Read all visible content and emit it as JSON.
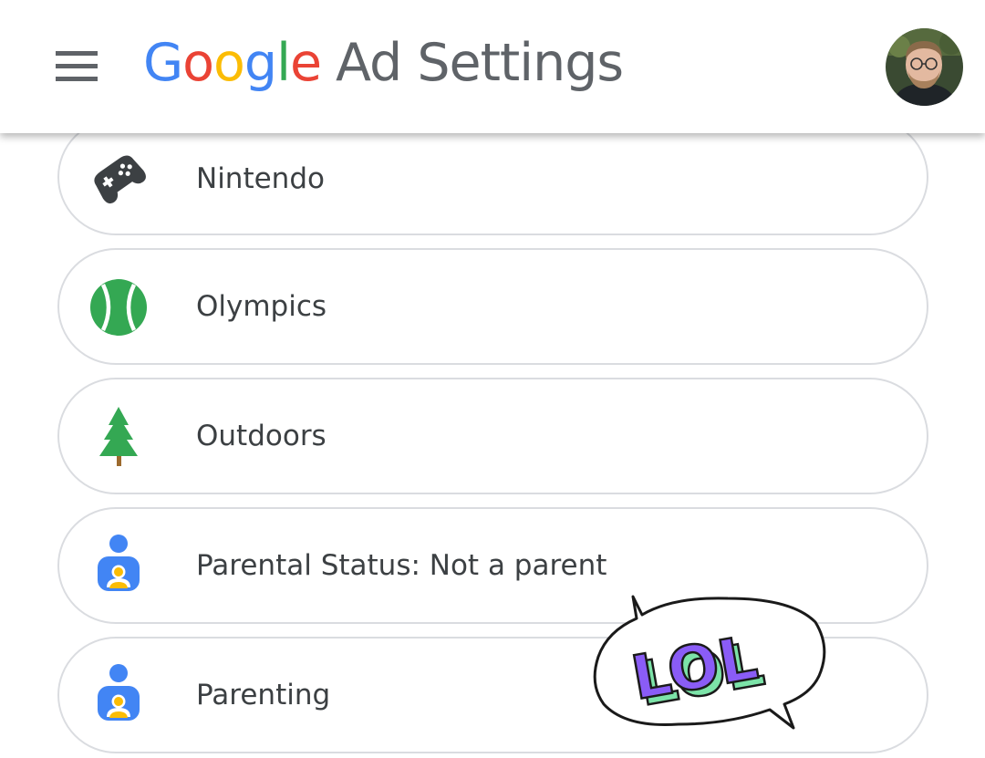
{
  "header": {
    "menu_icon": "hamburger-menu-icon",
    "brand": {
      "letters": [
        {
          "char": "G",
          "color": "#4285F4"
        },
        {
          "char": "o",
          "color": "#EA4335"
        },
        {
          "char": "o",
          "color": "#FBBC05"
        },
        {
          "char": "g",
          "color": "#4285F4"
        },
        {
          "char": "l",
          "color": "#34A853"
        },
        {
          "char": "e",
          "color": "#EA4335"
        }
      ],
      "product": "Ad Settings"
    },
    "avatar_icon": "user-avatar"
  },
  "topics": [
    {
      "label": "Nintendo",
      "icon": "gamepad-icon"
    },
    {
      "label": "Olympics",
      "icon": "tennis-ball-icon"
    },
    {
      "label": "Outdoors",
      "icon": "tree-icon"
    },
    {
      "label": "Parental Status: Not a parent",
      "icon": "person-icon"
    },
    {
      "label": "Parenting",
      "icon": "person-icon"
    }
  ],
  "sticker": {
    "text": "LOL",
    "fill_color": "#8a5cf6",
    "shadow_color": "#7ce3a8"
  },
  "colors": {
    "google_blue": "#4285F4",
    "google_red": "#EA4335",
    "google_yellow": "#FBBC05",
    "google_green": "#34A853",
    "icon_dark": "#3c4043",
    "card_border": "#dadce0"
  }
}
